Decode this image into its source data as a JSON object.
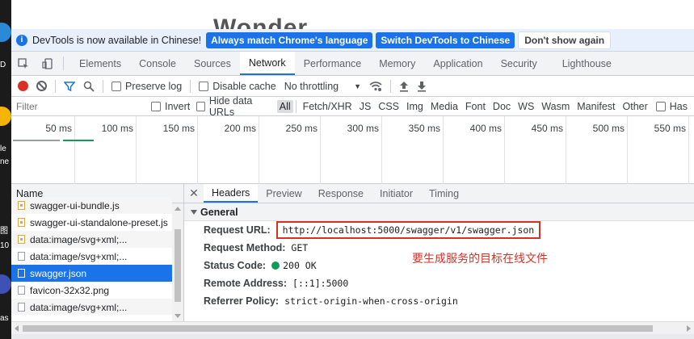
{
  "page": {
    "title_fragment": "Wonder"
  },
  "desktop": {
    "label_1": "D",
    "label_2": "le",
    "label_3": "ne",
    "label_4": "图",
    "label_5": "10",
    "label_6": "as"
  },
  "infobar": {
    "message": "DevTools is now available in Chinese!",
    "btn_match": "Always match Chrome's language",
    "btn_switch": "Switch DevTools to Chinese",
    "btn_dismiss": "Don't show again"
  },
  "tabs": [
    "Elements",
    "Console",
    "Sources",
    "Network",
    "Performance",
    "Memory",
    "Application",
    "Security",
    "Lighthouse"
  ],
  "toolbar": {
    "preserve_log": "Preserve log",
    "disable_cache": "Disable cache",
    "throttling": "No throttling"
  },
  "filterbar": {
    "placeholder": "Filter",
    "invert": "Invert",
    "hide_data_urls": "Hide data URLs",
    "types": [
      "All",
      "Fetch/XHR",
      "JS",
      "CSS",
      "Img",
      "Media",
      "Font",
      "Doc",
      "WS",
      "Wasm",
      "Manifest",
      "Other"
    ],
    "has": "Has"
  },
  "overview": {
    "ticks": [
      "50 ms",
      "100 ms",
      "150 ms",
      "200 ms",
      "250 ms",
      "300 ms",
      "350 ms",
      "400 ms",
      "450 ms",
      "500 ms",
      "550 ms"
    ]
  },
  "request_list": {
    "header": "Name",
    "rows": [
      {
        "name": "swagger-ui-bundle.js",
        "icon": "js"
      },
      {
        "name": "swagger-ui-standalone-preset.js",
        "icon": "js"
      },
      {
        "name": "data:image/svg+xml;...",
        "icon": "svg"
      },
      {
        "name": "data:image/svg+xml;...",
        "icon": "svg"
      },
      {
        "name": "swagger.json",
        "icon": "doc",
        "selected": true
      },
      {
        "name": "favicon-32x32.png",
        "icon": "doc"
      },
      {
        "name": "data:image/svg+xml;...",
        "icon": "svg"
      }
    ]
  },
  "details": {
    "close": "✕",
    "tabs": [
      "Headers",
      "Preview",
      "Response",
      "Initiator",
      "Timing"
    ],
    "section": "General",
    "request_url_key": "Request URL:",
    "request_url": "http://localhost:5000/swagger/v1/swagger.json",
    "method_key": "Request Method:",
    "method": "GET",
    "status_key": "Status Code:",
    "status": "200 OK",
    "remote_key": "Remote Address:",
    "remote": "[::1]:5000",
    "referrer_key": "Referrer Policy:",
    "referrer": "strict-origin-when-cross-origin",
    "annotation": "要生成服务的目标在线文件"
  },
  "colors": {
    "accent": "#1a73e8",
    "record": "#d93025",
    "status_ok": "#0f9d58",
    "annotation": "#d93025"
  }
}
